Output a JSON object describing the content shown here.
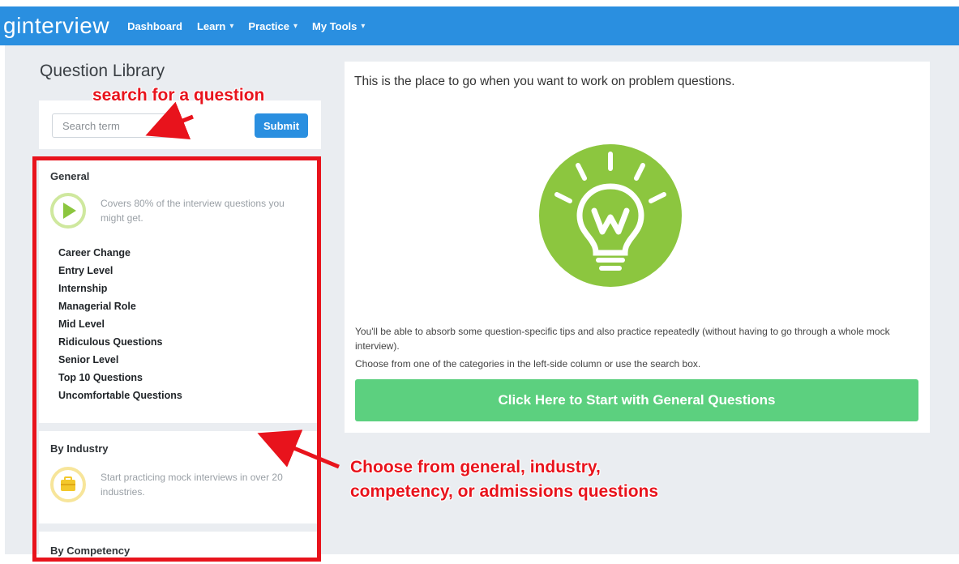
{
  "navbar": {
    "brand": "ginterview",
    "items": [
      {
        "label": "Dashboard",
        "dropdown": false
      },
      {
        "label": "Learn",
        "dropdown": true
      },
      {
        "label": "Practice",
        "dropdown": true
      },
      {
        "label": "My Tools",
        "dropdown": true
      }
    ],
    "caret": "▾"
  },
  "sidebar": {
    "title": "Question Library",
    "search": {
      "placeholder": "Search term",
      "submit_label": "Submit"
    },
    "categories": [
      {
        "title": "General",
        "icon": "play-icon",
        "description": "Covers 80% of the interview questions you might get.",
        "items": [
          "Career Change",
          "Entry Level",
          "Internship",
          "Managerial Role",
          "Mid Level",
          "Ridiculous Questions",
          "Senior Level",
          "Top 10 Questions",
          "Uncomfortable Questions"
        ]
      },
      {
        "title": "By Industry",
        "icon": "briefcase-icon",
        "description": "Start practicing mock interviews in over 20 industries."
      },
      {
        "title": "By Competency"
      }
    ]
  },
  "main": {
    "intro": "This is the place to go when you want to work on problem questions.",
    "icon": "lightbulb-icon",
    "paragraph1": "You'll be able to absorb some question-specific tips and also practice repeatedly (without having to go through a whole mock interview).",
    "paragraph2": "Choose from one of the categories in the left-side column or use the search box.",
    "cta_label": "Click Here to Start with General Questions"
  },
  "annotations": {
    "search_note": "search for a question",
    "choose_note_line1": "Choose from general, industry,",
    "choose_note_line2": "competency, or admissions questions"
  },
  "colors": {
    "navbar": "#2a8fe0",
    "background": "#eaedf1",
    "green": "#8cc63f",
    "cta": "#5cd07f",
    "annotation": "#e8131c",
    "industry_icon": "#f3c82b"
  }
}
